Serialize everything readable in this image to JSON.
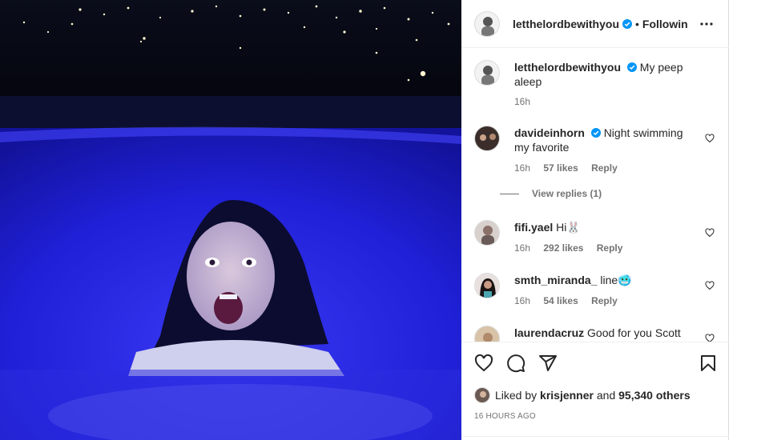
{
  "post": {
    "author": "letthelordbewithyou",
    "following_label": "Following",
    "dot": "•",
    "caption_user": "letthelordbewithyou",
    "caption_text": "My peep aleep",
    "caption_time": "16h"
  },
  "comments": [
    {
      "user": "davideinhorn",
      "text": "Night swimming my favorite",
      "time": "16h",
      "likes": "57 likes",
      "reply": "Reply",
      "verified": true
    },
    {
      "user": "fifi.yael",
      "text": "Hi🐰",
      "time": "16h",
      "likes": "292 likes",
      "reply": "Reply"
    },
    {
      "user": "smth_miranda_",
      "text": "line🥶",
      "time": "16h",
      "likes": "54 likes",
      "reply": "Reply"
    },
    {
      "user": "laurendacruz",
      "text": "Good for you Scott"
    }
  ],
  "view_replies": "View replies (1)",
  "footer": {
    "liked_by_prefix": "Liked by",
    "liked_by_user": "krisjenner",
    "and": "and",
    "others_count": "95,340 others",
    "date": "16 HOURS AGO"
  },
  "colors": {
    "pool": "#2a2ae0",
    "verified": "#0095f6"
  }
}
